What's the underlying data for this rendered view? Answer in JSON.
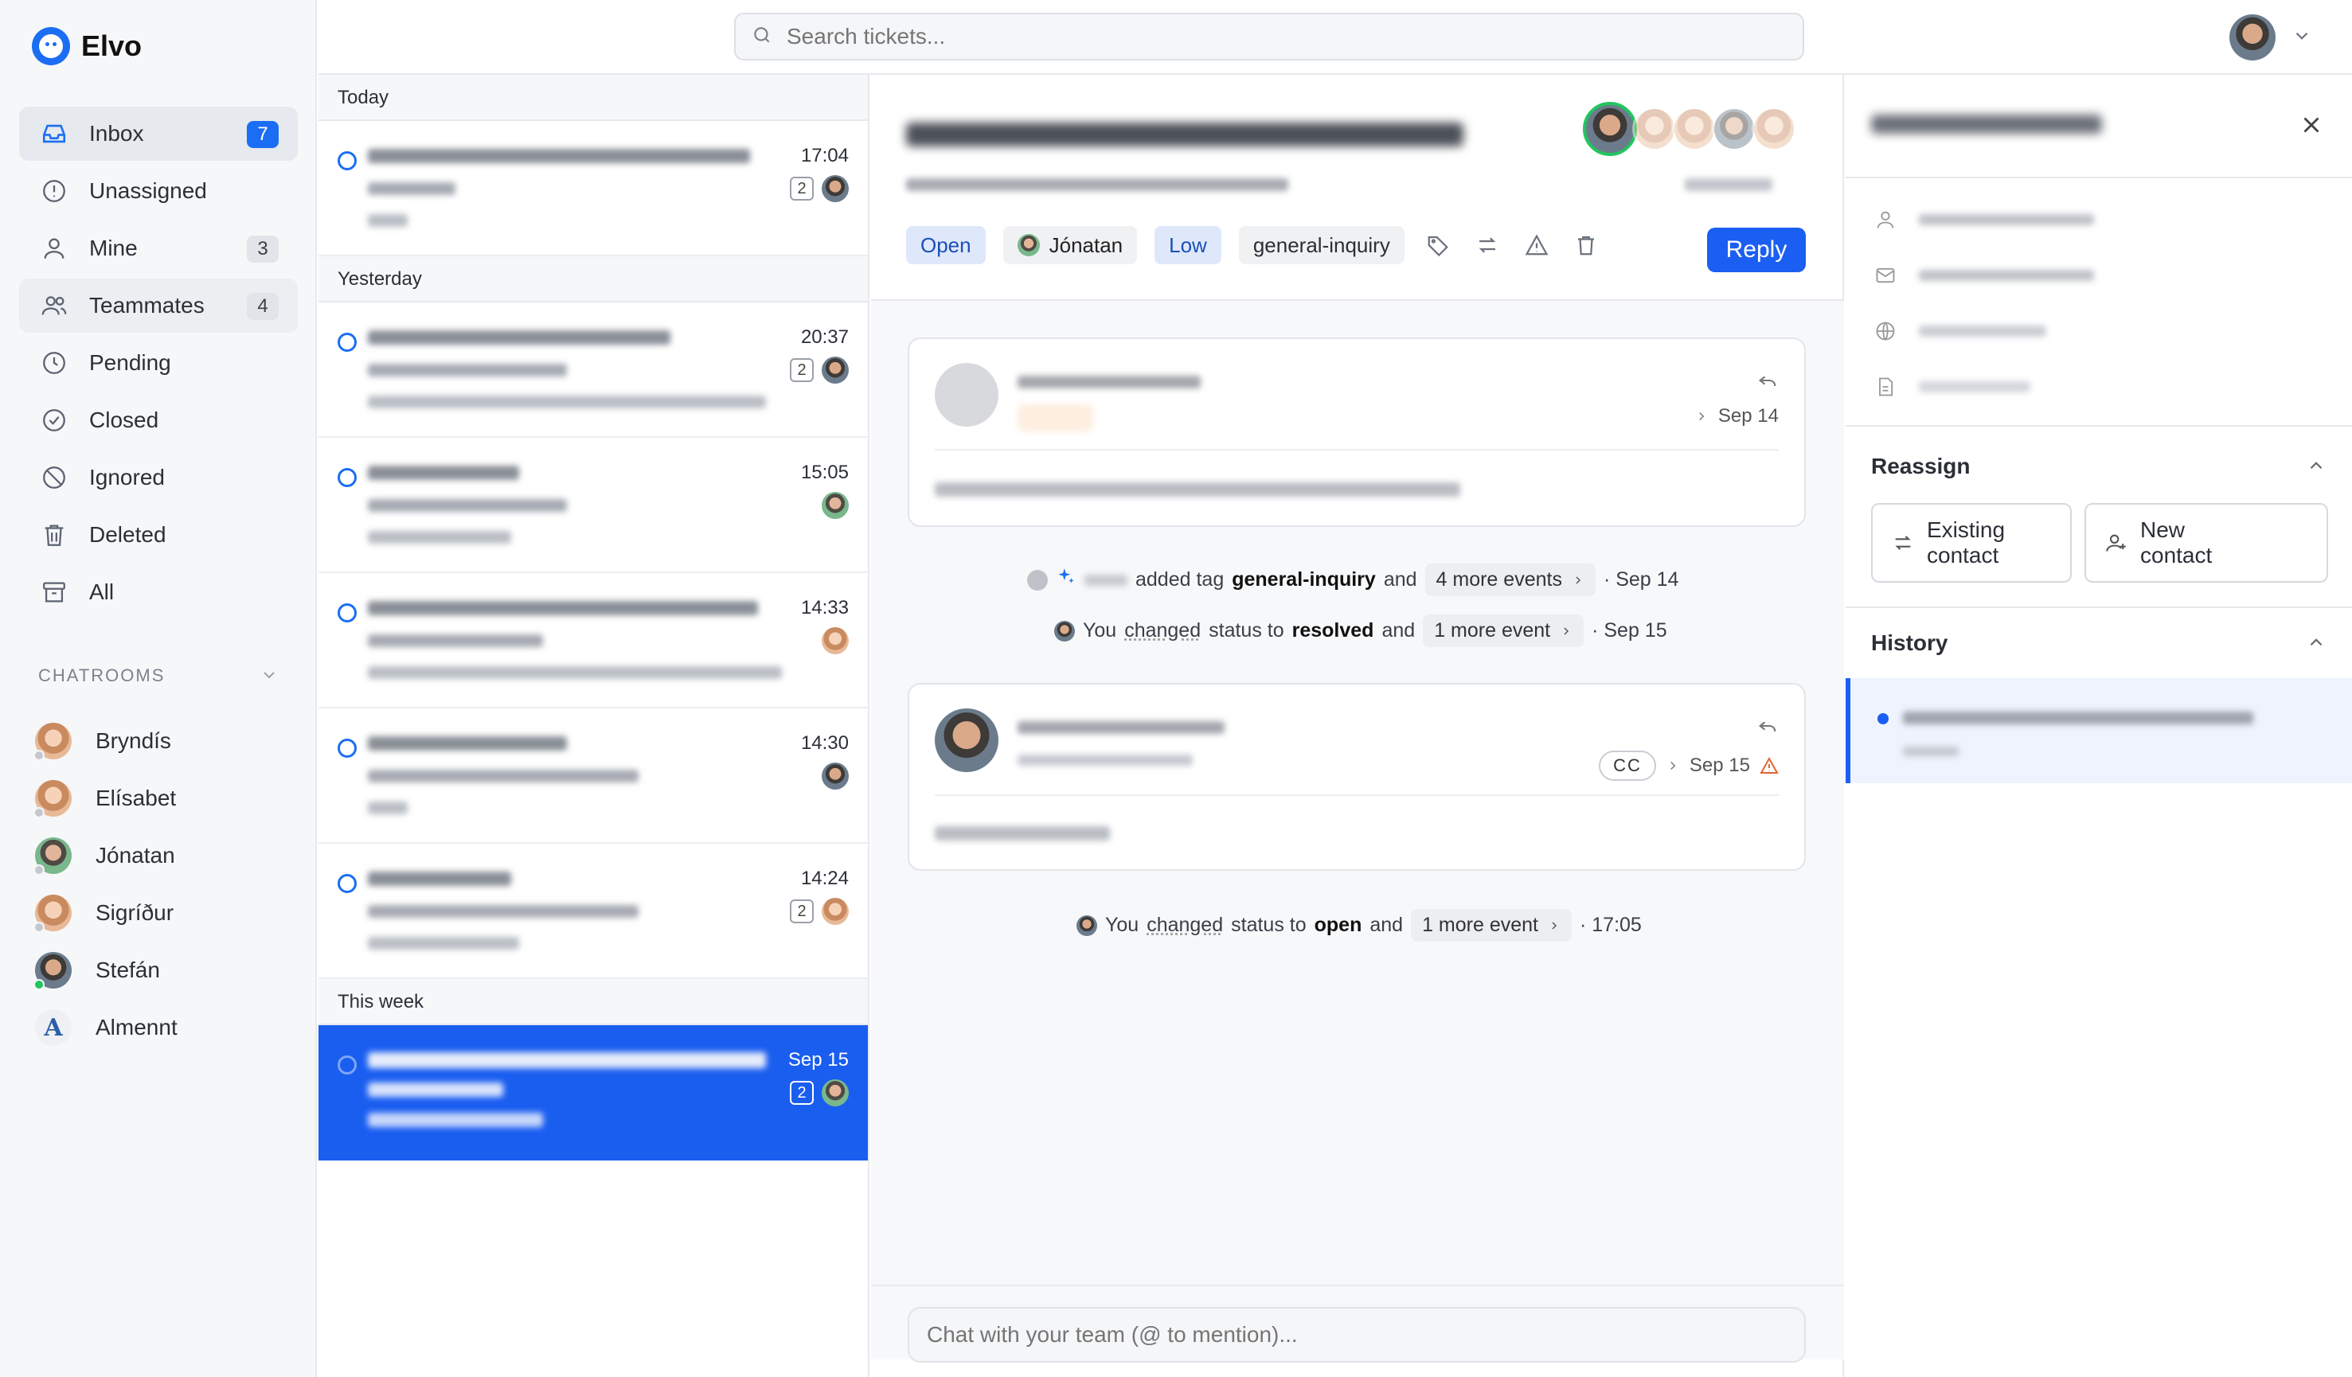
{
  "app": {
    "name": "Elvo"
  },
  "search": {
    "placeholder": "Search tickets..."
  },
  "sidebar": {
    "nav": [
      {
        "label": "Inbox",
        "count": "7",
        "icon": "inbox-icon"
      },
      {
        "label": "Unassigned",
        "count": "",
        "icon": "alert-circle-icon"
      },
      {
        "label": "Mine",
        "count": "3",
        "icon": "user-icon"
      },
      {
        "label": "Teammates",
        "count": "4",
        "icon": "users-icon"
      },
      {
        "label": "Pending",
        "count": "",
        "icon": "clock-icon"
      },
      {
        "label": "Closed",
        "count": "",
        "icon": "check-circle-icon"
      },
      {
        "label": "Ignored",
        "count": "",
        "icon": "ban-icon"
      },
      {
        "label": "Deleted",
        "count": "",
        "icon": "trash-icon"
      },
      {
        "label": "All",
        "count": "",
        "icon": "archive-icon"
      }
    ],
    "chatrooms_label": "CHATROOMS",
    "chatrooms": [
      {
        "name": "Bryndís"
      },
      {
        "name": "Elísabet"
      },
      {
        "name": "Jónatan"
      },
      {
        "name": "Sigríður"
      },
      {
        "name": "Stefán"
      },
      {
        "name": "Almennt",
        "letter": "A"
      }
    ]
  },
  "ticket_list": {
    "sections": [
      "Today",
      "Yesterday",
      "This week"
    ],
    "tickets": [
      {
        "time": "17:04",
        "count": "2"
      },
      {
        "time": "20:37",
        "count": "2"
      },
      {
        "time": "15:05",
        "count": ""
      },
      {
        "time": "14:33",
        "count": ""
      },
      {
        "time": "14:30",
        "count": ""
      },
      {
        "time": "14:24",
        "count": "2"
      },
      {
        "time": "Sep 15",
        "count": "2"
      }
    ]
  },
  "conversation": {
    "status": "Open",
    "assignee": "Jónatan",
    "priority": "Low",
    "tag": "general-inquiry",
    "reply_label": "Reply",
    "messages": [
      {
        "date": "Sep 14"
      },
      {
        "date": "Sep 15",
        "cc": "CC"
      }
    ],
    "events": {
      "e1": {
        "text": "added tag",
        "tag": "general-inquiry",
        "and": "and",
        "more": "4 more events",
        "date": "· Sep 14"
      },
      "e2": {
        "you": "You",
        "verb": "changed",
        "mid": "status to",
        "value": "resolved",
        "and": "and",
        "more": "1 more event",
        "date": "· Sep 15"
      },
      "e3": {
        "you": "You",
        "verb": "changed",
        "mid": "status to",
        "value": "open",
        "and": "and",
        "more": "1 more event",
        "date": "· 17:05"
      }
    },
    "composer_placeholder": "Chat with your team (@ to mention)..."
  },
  "right_panel": {
    "reassign_title": "Reassign",
    "existing_contact": "Existing contact",
    "new_contact": "New contact",
    "history_title": "History"
  },
  "colors": {
    "accent": "#1b5ef2",
    "online": "#22c55e",
    "warning": "#e0662e"
  }
}
